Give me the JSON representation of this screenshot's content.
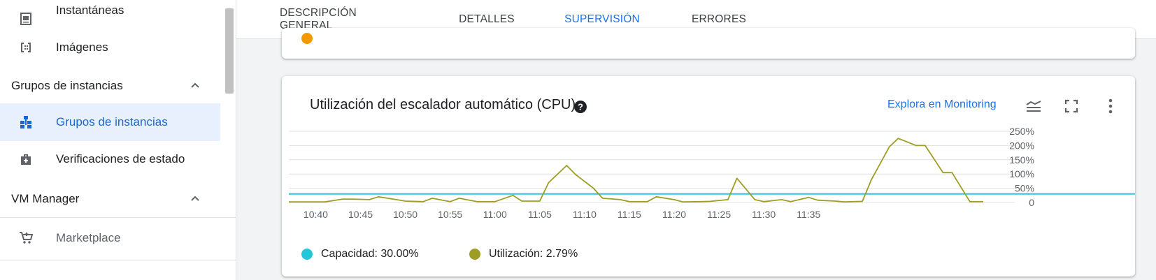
{
  "sidebar": {
    "items": [
      {
        "label": "Instantáneas",
        "icon": "snapshot-icon"
      },
      {
        "label": "Imágenes",
        "icon": "image-icon"
      }
    ],
    "section_groups": {
      "label": "Grupos de instancias",
      "expanded": true
    },
    "group_items": [
      {
        "label": "Grupos de instancias",
        "icon": "instance-groups-icon",
        "active": true
      },
      {
        "label": "Verificaciones de estado",
        "icon": "health-check-icon"
      }
    ],
    "section_vm": {
      "label": "VM Manager",
      "expanded": true
    },
    "vm_items": [
      {
        "label": "Marketplace",
        "icon": "marketplace-cart-icon"
      }
    ]
  },
  "tabs": [
    {
      "label": "DESCRIPCIÓN GENERAL",
      "active": false
    },
    {
      "label": "DETALLES",
      "active": false
    },
    {
      "label": "SUPERVISIÓN",
      "active": true
    },
    {
      "label": "ERRORES",
      "active": false
    }
  ],
  "chart_card": {
    "title": "Utilización del escalador automático (CPU)",
    "explore_link": "Explora en Monitoring",
    "icons": [
      "help-icon",
      "legend-toggle-icon",
      "fullscreen-icon",
      "more-vert-icon"
    ]
  },
  "colors": {
    "accent": "#1a73e8",
    "capacity": "#26c6da",
    "utilization": "#9e9d24"
  },
  "chart_data": {
    "type": "line",
    "x_ticks": [
      "10:40",
      "10:45",
      "10:50",
      "10:55",
      "11:00",
      "11:05",
      "11:10",
      "11:15",
      "11:20",
      "11:25",
      "11:30",
      "11:35"
    ],
    "y_ticks": [
      "250%",
      "200%",
      "150%",
      "100%",
      "50%",
      "0"
    ],
    "ylim": [
      0,
      250
    ],
    "x_range_min": [
      37,
      755
    ],
    "grid": true,
    "series": [
      {
        "name": "Capacidad",
        "legend_text": "Capacidad: 30.00%",
        "color": "#26c6da",
        "x": [
          37,
          755
        ],
        "y": [
          30,
          30
        ]
      },
      {
        "name": "Utilización",
        "legend_text": "Utilización: 2.79%",
        "color": "#9e9d24",
        "x": [
          37,
          39,
          41,
          43,
          44,
          46,
          47,
          49,
          50,
          52,
          53,
          55,
          56,
          58,
          59,
          60,
          62,
          63,
          65,
          66,
          68,
          69,
          71,
          72,
          74,
          75,
          77,
          78,
          80,
          81,
          83,
          84,
          86,
          87,
          89,
          90,
          92,
          93,
          95,
          96,
          98,
          99,
          101,
          102,
          104,
          105,
          107,
          108,
          110,
          111,
          113,
          114,
          114.5
        ],
        "y": [
          2,
          2,
          2,
          12,
          12,
          10,
          20,
          10,
          5,
          3,
          15,
          3,
          15,
          3,
          3,
          3,
          25,
          5,
          5,
          70,
          130,
          98,
          50,
          15,
          10,
          3,
          3,
          20,
          10,
          2,
          3,
          4,
          10,
          85,
          10,
          3,
          10,
          3,
          18,
          8,
          5,
          2,
          4,
          80,
          195,
          225,
          200,
          200,
          105,
          105,
          3,
          3,
          3
        ]
      }
    ]
  }
}
